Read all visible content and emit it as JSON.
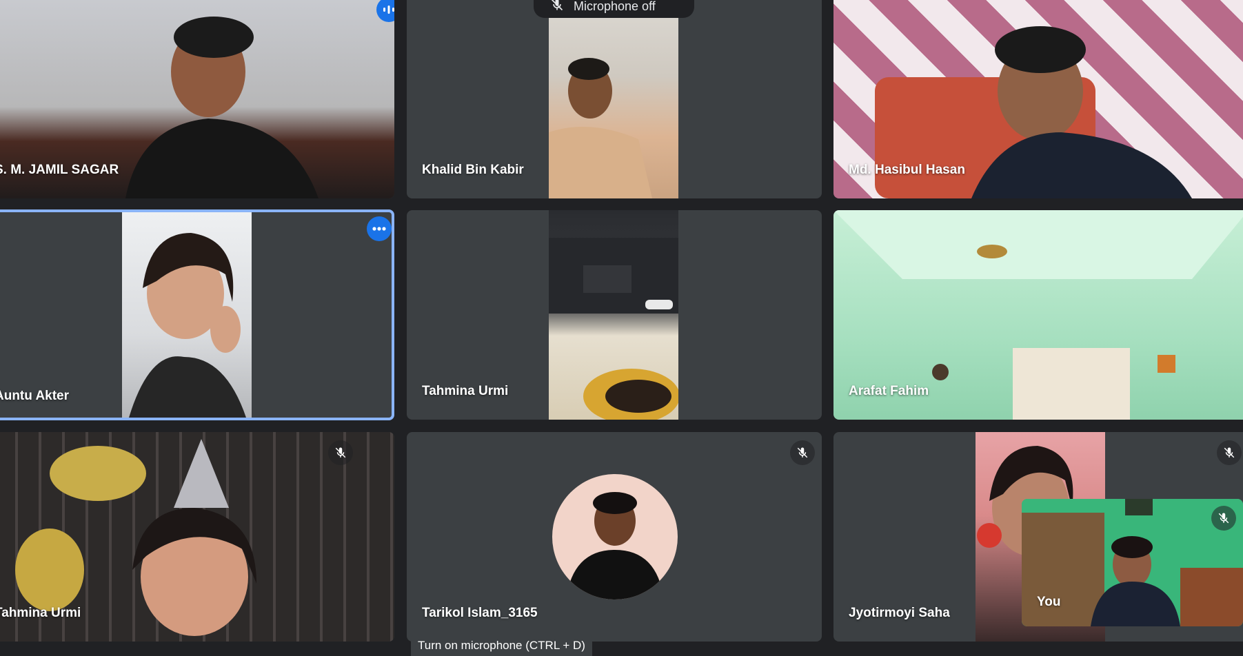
{
  "toast": {
    "text": "Microphone off",
    "icon": "mic-off-icon"
  },
  "tooltip": {
    "text": "Turn on microphone (CTRL + D)"
  },
  "participants": [
    {
      "name": "S. M. JAMIL SAGAR",
      "status": "speaking"
    },
    {
      "name": "Khalid Bin Kabir",
      "status": ""
    },
    {
      "name": "Md. Hasibul Hasan",
      "status": ""
    },
    {
      "name": "Auntu Akter",
      "status": "pinned-options"
    },
    {
      "name": "Tahmina Urmi",
      "status": ""
    },
    {
      "name": "Arafat Fahim",
      "status": ""
    },
    {
      "name": "Tahmina Urmi",
      "status": "muted"
    },
    {
      "name": "Tarikol Islam_3165",
      "status": "muted"
    },
    {
      "name": "Jyotirmoyi Saha",
      "status": "muted"
    }
  ],
  "self_view": {
    "label": "You",
    "status": "muted"
  },
  "colors": {
    "background": "#202124",
    "tile": "#3c4043",
    "accent_blue": "#1a73e8",
    "active_outline": "#8ab4f8"
  }
}
